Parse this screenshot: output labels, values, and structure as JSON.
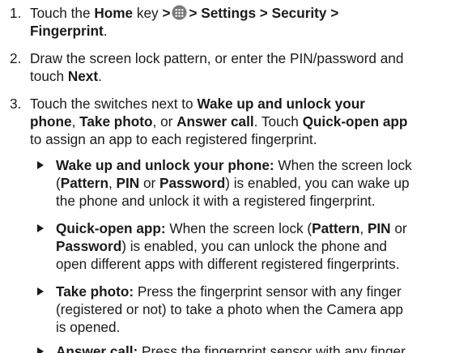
{
  "steps": [
    {
      "number": "1.",
      "lines": [
        [
          {
            "t": "Touch the ",
            "b": false
          },
          {
            "t": "Home",
            "b": true
          },
          {
            "t": " key ",
            "b": false
          },
          {
            "t": ">",
            "b": true
          },
          {
            "icon": "apps-icon"
          },
          {
            "t": "> Settings > Security >",
            "b": true
          }
        ],
        [
          {
            "t": "Fingerprint",
            "b": true
          },
          {
            "t": ".",
            "b": false
          }
        ]
      ]
    },
    {
      "number": "2.",
      "lines": [
        [
          {
            "t": "Draw the screen lock pattern, or enter the PIN/password and",
            "b": false
          }
        ],
        [
          {
            "t": "touch ",
            "b": false
          },
          {
            "t": "Next",
            "b": true
          },
          {
            "t": ".",
            "b": false
          }
        ]
      ]
    },
    {
      "number": "3.",
      "lines": [
        [
          {
            "t": "Touch the switches next to ",
            "b": false
          },
          {
            "t": "Wake up and unlock your",
            "b": true
          }
        ],
        [
          {
            "t": "phone",
            "b": true
          },
          {
            "t": ", ",
            "b": false
          },
          {
            "t": "Take photo",
            "b": true
          },
          {
            "t": ", or ",
            "b": false
          },
          {
            "t": "Answer call",
            "b": true
          },
          {
            "t": ". Touch ",
            "b": false
          },
          {
            "t": "Quick-open app",
            "b": true
          }
        ],
        [
          {
            "t": "to assign an app to each registered fingerprint.",
            "b": false
          }
        ]
      ]
    }
  ],
  "bullets": [
    {
      "lines": [
        [
          {
            "t": "Wake up and unlock your phone:",
            "b": true
          },
          {
            "t": " When the screen lock",
            "b": false
          }
        ],
        [
          {
            "t": "(",
            "b": false
          },
          {
            "t": "Pattern",
            "b": true
          },
          {
            "t": ", ",
            "b": false
          },
          {
            "t": "PIN",
            "b": true
          },
          {
            "t": " or ",
            "b": false
          },
          {
            "t": "Password",
            "b": true
          },
          {
            "t": ") is enabled, you can wake up",
            "b": false
          }
        ],
        [
          {
            "t": "the phone and unlock it with a registered fingerprint.",
            "b": false
          }
        ]
      ]
    },
    {
      "lines": [
        [
          {
            "t": "Quick-open app:",
            "b": true
          },
          {
            "t": " When the screen lock (",
            "b": false
          },
          {
            "t": "Pattern",
            "b": true
          },
          {
            "t": ", ",
            "b": false
          },
          {
            "t": "PIN",
            "b": true
          },
          {
            "t": " or",
            "b": false
          }
        ],
        [
          {
            "t": "Password",
            "b": true
          },
          {
            "t": ") is enabled, you can unlock the phone and",
            "b": false
          }
        ],
        [
          {
            "t": "open different apps with different registered fingerprints.",
            "b": false
          }
        ]
      ]
    },
    {
      "lines": [
        [
          {
            "t": "Take photo:",
            "b": true
          },
          {
            "t": " Press the fingerprint sensor with any finger",
            "b": false
          }
        ],
        [
          {
            "t": "(registered or not) to take a photo when the Camera app",
            "b": false
          }
        ],
        [
          {
            "t": "is opened.",
            "b": false
          }
        ]
      ]
    },
    {
      "lines": [
        [
          {
            "t": "Answer call:",
            "b": true
          },
          {
            "t": " Press the fingerprint sensor with any finger",
            "b": false
          }
        ]
      ]
    }
  ]
}
